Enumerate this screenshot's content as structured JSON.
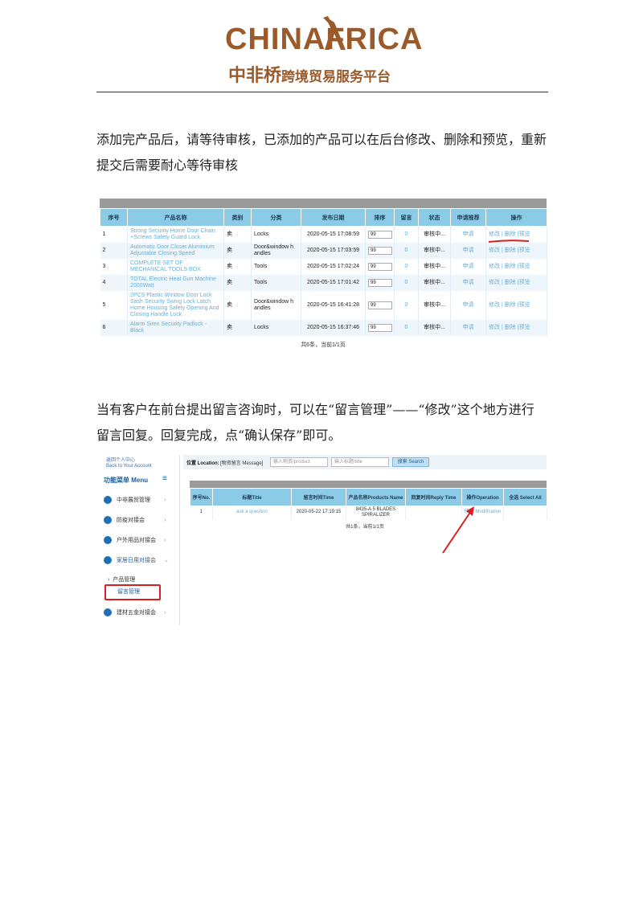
{
  "header": {
    "logo_en": "CHINAFRICA",
    "logo_cn_main": "中非桥",
    "logo_cn_sub": "跨境贸易服务平台"
  },
  "para1": "添加完产品后，请等待审核，已添加的产品可以在后台修改、删除和预览，重新提交后需要耐心等待审核",
  "para2": "当有客户在前台提出留言咨询时，可以在“留言管理”——“修改”这个地方进行留言回复。回复完成，点“确认保存”即可。",
  "product_table": {
    "headers": [
      "序号",
      "产品名称",
      "类别",
      "分类",
      "发布日期",
      "排序",
      "留言",
      "状态",
      "申请推荐",
      "操作"
    ],
    "rows": [
      {
        "no": "1",
        "name": "Strong Security Home Door Chain +Screws Safety Guard Lock",
        "type": "卖",
        "cat": "Locks",
        "date": "2020-05-15 17:08:59",
        "sort": "99",
        "msg": "0",
        "status": "审核中...",
        "rec": "申请",
        "ops": "修改 | 删除 |预览"
      },
      {
        "no": "2",
        "name": "Automatic Door Closer Aluminium Adjustable Closing Speed",
        "type": "卖",
        "cat": "Door&window h andles",
        "date": "2020-05-15 17:03:59",
        "sort": "99",
        "msg": "0",
        "status": "审核中...",
        "rec": "申请",
        "ops": "修改 | 删除 |预览"
      },
      {
        "no": "3",
        "name": "COMPLETE SET OF MECHANICAL TOOLS BOX",
        "type": "卖",
        "cat": "Tools",
        "date": "2020-05-15 17:02:24",
        "sort": "99",
        "msg": "0",
        "status": "审核中...",
        "rec": "申请",
        "ops": "修改 | 删除 |预览"
      },
      {
        "no": "4",
        "name": "TOTAL Electric Heat Gun Machine 2000Watt",
        "type": "卖",
        "cat": "Tools",
        "date": "2020-05-15 17:01:42",
        "sort": "99",
        "msg": "0",
        "status": "审核中...",
        "rec": "申请",
        "ops": "修改 | 删除 |预览"
      },
      {
        "no": "5",
        "name": "2PCS Plastic Window Door Lock Sash Security Swing Lock Latch Home Housing Safety Opening And Closing Handle Lock",
        "type": "卖",
        "cat": "Door&window h andles",
        "date": "2020-05-15 16:41:28",
        "sort": "99",
        "msg": "0",
        "status": "审核中...",
        "rec": "申请",
        "ops": "修改 | 删除 |预览"
      },
      {
        "no": "6",
        "name": "Alarm Siren Security Padlock - Black",
        "type": "卖",
        "cat": "Locks",
        "date": "2020-05-15 16:37:46",
        "sort": "99",
        "msg": "0",
        "status": "审核中...",
        "rec": "申请",
        "ops": "修改 | 删除 |预览"
      }
    ],
    "footer": "共6条，当前1/1页"
  },
  "message_ui": {
    "back_link": "返回个人中心\nBack to Your Account",
    "menu_title": "功能菜单 Menu",
    "menu_icon": "hamburger-icon",
    "menu_items": [
      {
        "label": "中非展贸管理"
      },
      {
        "label": "防疫对接会"
      },
      {
        "label": "户外用品对接会"
      },
      {
        "label": "家居日用对接会"
      },
      {
        "label": "建材五金对接会"
      }
    ],
    "sub_items": [
      "产品管理",
      "留言管理"
    ],
    "location_label": "位置 Location:",
    "location_path": "[物资留言 Message]",
    "input1_placeholder": "输入物资/product",
    "input2_placeholder": "输入标题/title",
    "search_button": "搜索 Search",
    "headers": [
      "序号No.",
      "标题Title",
      "留言时间Time",
      "产品名称Products Name",
      "回复时间Reply Time",
      "操作Operation",
      "全选 Select All"
    ],
    "row": {
      "no": "1",
      "title": "ask a question",
      "time": "2020-05-22 17:19:15",
      "product": "8435-A 5 BLADES SPIRALIZER",
      "reply": "",
      "op": "修改 Modification"
    },
    "footer": "共1条，当前1/1页"
  },
  "colors": {
    "brand": "#9a5a2a",
    "table_header": "#8ccbe8",
    "link": "#6aaed6",
    "highlight": "#d81e1e"
  }
}
